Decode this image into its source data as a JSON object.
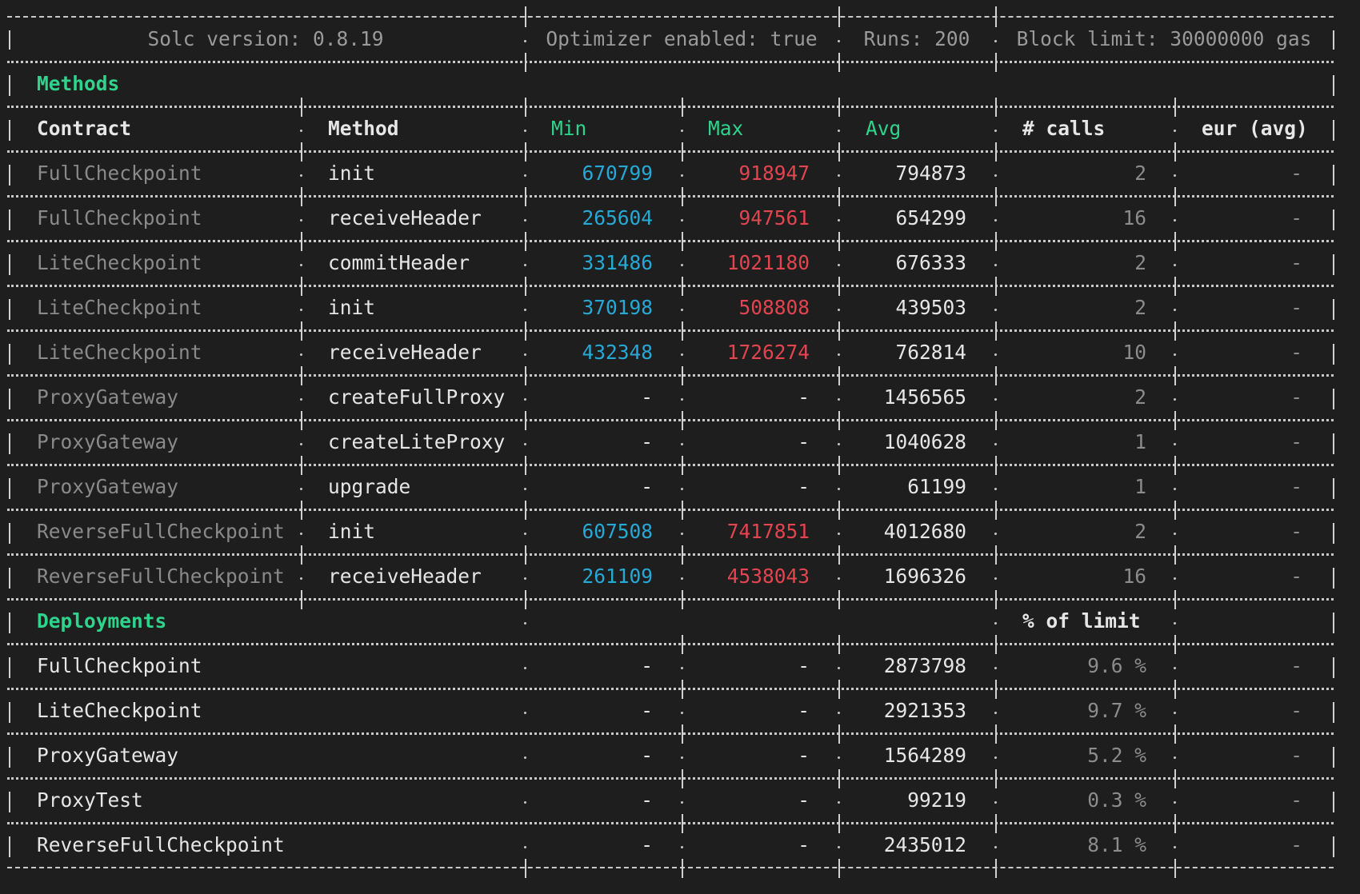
{
  "header": {
    "solc_version": "Solc version: 0.8.19",
    "optimizer": "Optimizer enabled: true",
    "runs": "Runs: 200",
    "block_limit": "Block limit: 30000000 gas"
  },
  "methods_section": {
    "title": "Methods",
    "columns": [
      "Contract",
      "Method",
      "Min",
      "Max",
      "Avg",
      "# calls",
      "eur (avg)"
    ],
    "rows": [
      {
        "contract": "FullCheckpoint",
        "method": "init",
        "min": "670799",
        "max": "918947",
        "avg": "794873",
        "calls": "2",
        "eur": "-"
      },
      {
        "contract": "FullCheckpoint",
        "method": "receiveHeader",
        "min": "265604",
        "max": "947561",
        "avg": "654299",
        "calls": "16",
        "eur": "-"
      },
      {
        "contract": "LiteCheckpoint",
        "method": "commitHeader",
        "min": "331486",
        "max": "1021180",
        "avg": "676333",
        "calls": "2",
        "eur": "-"
      },
      {
        "contract": "LiteCheckpoint",
        "method": "init",
        "min": "370198",
        "max": "508808",
        "avg": "439503",
        "calls": "2",
        "eur": "-"
      },
      {
        "contract": "LiteCheckpoint",
        "method": "receiveHeader",
        "min": "432348",
        "max": "1726274",
        "avg": "762814",
        "calls": "10",
        "eur": "-"
      },
      {
        "contract": "ProxyGateway",
        "method": "createFullProxy",
        "min": "-",
        "max": "-",
        "avg": "1456565",
        "calls": "2",
        "eur": "-"
      },
      {
        "contract": "ProxyGateway",
        "method": "createLiteProxy",
        "min": "-",
        "max": "-",
        "avg": "1040628",
        "calls": "1",
        "eur": "-"
      },
      {
        "contract": "ProxyGateway",
        "method": "upgrade",
        "min": "-",
        "max": "-",
        "avg": "61199",
        "calls": "1",
        "eur": "-"
      },
      {
        "contract": "ReverseFullCheckpoint",
        "method": "init",
        "min": "607508",
        "max": "7417851",
        "avg": "4012680",
        "calls": "2",
        "eur": "-"
      },
      {
        "contract": "ReverseFullCheckpoint",
        "method": "receiveHeader",
        "min": "261109",
        "max": "4538043",
        "avg": "1696326",
        "calls": "16",
        "eur": "-"
      }
    ]
  },
  "deployments_section": {
    "title": "Deployments",
    "limit_header": "% of limit",
    "rows": [
      {
        "contract": "FullCheckpoint",
        "min": "-",
        "max": "-",
        "avg": "2873798",
        "pct": "9.6 %",
        "eur": "-"
      },
      {
        "contract": "LiteCheckpoint",
        "min": "-",
        "max": "-",
        "avg": "2921353",
        "pct": "9.7 %",
        "eur": "-"
      },
      {
        "contract": "ProxyGateway",
        "min": "-",
        "max": "-",
        "avg": "1564289",
        "pct": "5.2 %",
        "eur": "-"
      },
      {
        "contract": "ProxyTest",
        "min": "-",
        "max": "-",
        "avg": "99219",
        "pct": "0.3 %",
        "eur": "-"
      },
      {
        "contract": "ReverseFullCheckpoint",
        "min": "-",
        "max": "-",
        "avg": "2435012",
        "pct": "8.1 %",
        "eur": "-"
      }
    ]
  },
  "colors": {
    "background": "#1e1e1e",
    "section_title": "#2fd48c",
    "min_value": "#27a9d6",
    "max_value": "#e2454f",
    "text": "#e6e6e6",
    "dim_text": "#8a8a8a"
  }
}
